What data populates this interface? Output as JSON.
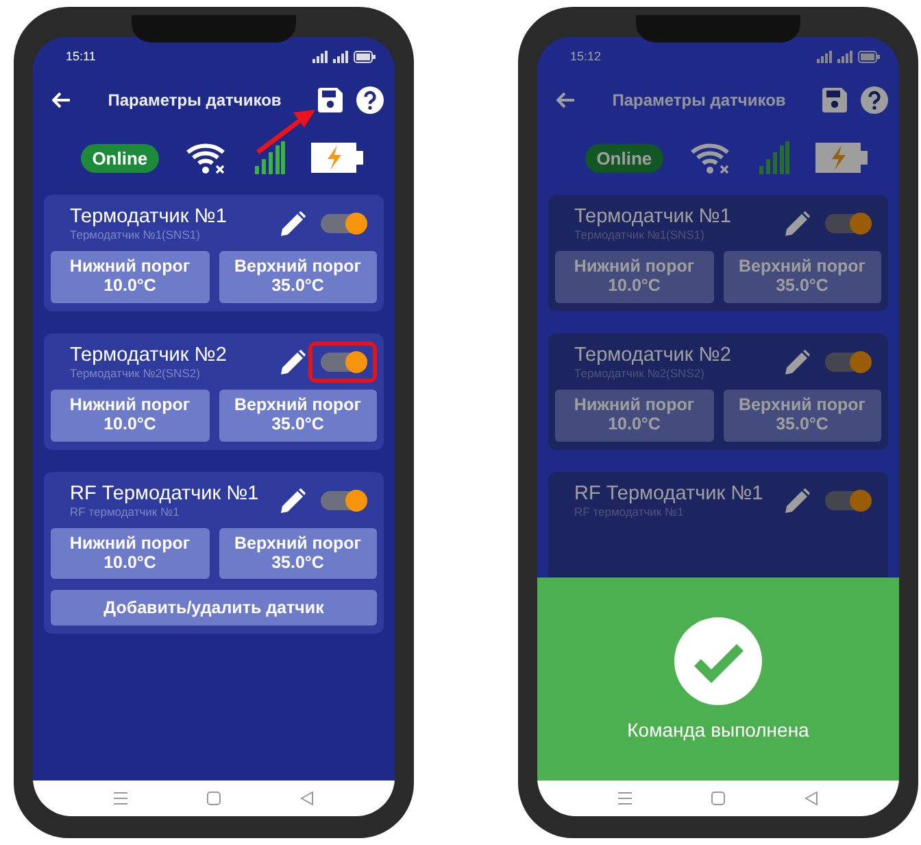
{
  "phones": [
    {
      "time": "15:11",
      "title": "Параметры датчиков",
      "save_pointer": true,
      "dimmed": false,
      "status_label": "Online",
      "sensors": [
        {
          "name": "Термодатчик №1",
          "subtitle": "Термодатчик №1(SNS1)",
          "on": true,
          "highlighted": false,
          "thresholds": [
            {
              "label": "Нижний порог",
              "value": "10.0°C"
            },
            {
              "label": "Верхний порог",
              "value": "35.0°C"
            }
          ]
        },
        {
          "name": "Термодатчик №2",
          "subtitle": "Термодатчик №2(SNS2)",
          "on": true,
          "highlighted": true,
          "thresholds": [
            {
              "label": "Нижний порог",
              "value": "10.0°C"
            },
            {
              "label": "Верхний порог",
              "value": "35.0°C"
            }
          ]
        },
        {
          "name": "RF Термодатчик №1",
          "subtitle": "RF термодатчик №1",
          "on": true,
          "highlighted": false,
          "thresholds": [
            {
              "label": "Нижний порог",
              "value": "10.0°C"
            },
            {
              "label": "Верхний порог",
              "value": "35.0°C"
            }
          ]
        }
      ],
      "add_button": "Добавить/удалить датчик"
    },
    {
      "time": "15:12",
      "title": "Параметры датчиков",
      "save_pointer": false,
      "dimmed": true,
      "status_label": "Online",
      "sensors": [
        {
          "name": "Термодатчик №1",
          "subtitle": "Термодатчик №1(SNS1)",
          "on": true,
          "highlighted": false,
          "thresholds": [
            {
              "label": "Нижний порог",
              "value": "10.0°C"
            },
            {
              "label": "Верхний порог",
              "value": "35.0°C"
            }
          ]
        },
        {
          "name": "Термодатчик №2",
          "subtitle": "Термодатчик №2(SNS2)",
          "on": true,
          "highlighted": false,
          "thresholds": [
            {
              "label": "Нижний порог",
              "value": "10.0°C"
            },
            {
              "label": "Верхний порог",
              "value": "35.0°C"
            }
          ]
        },
        {
          "name": "RF Термодатчик №1",
          "subtitle": "RF термодатчик №1",
          "on": true,
          "highlighted": false
        }
      ],
      "toast": {
        "message": "Команда выполнена"
      }
    }
  ]
}
